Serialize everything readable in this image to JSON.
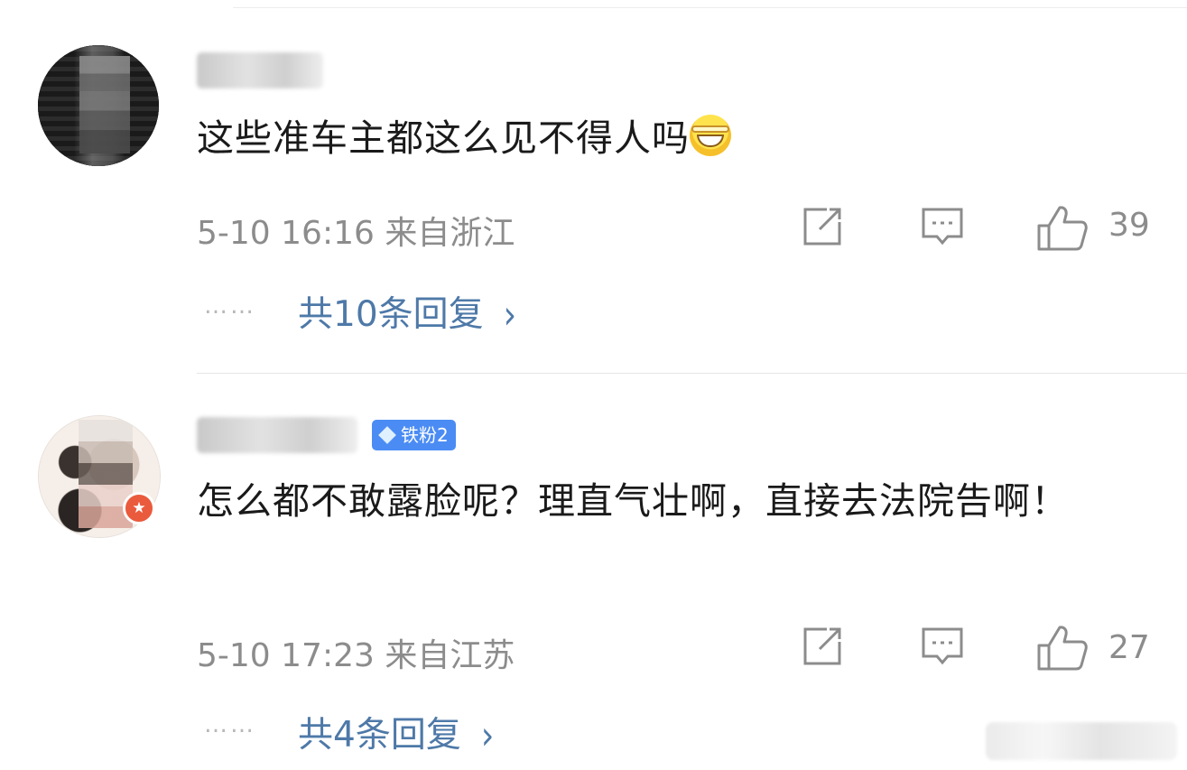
{
  "comments": [
    {
      "text": "这些准车主都这么见不得人吗",
      "emoji": "laughing-crying-emoji",
      "time": "5-10 16:16",
      "location": "来自浙江",
      "likes": "39",
      "replies": "共10条回复",
      "dots": "……"
    },
    {
      "badge": "铁粉2",
      "text": "怎么都不敢露脸呢？理直气壮啊，直接去法院告啊！",
      "time": "5-10 17:23",
      "location": "来自江苏",
      "likes": "27",
      "replies": "共4条回复",
      "dots": "……"
    }
  ],
  "icons": {
    "share": "share-icon",
    "comment": "comment-icon",
    "like": "thumbs-up-icon",
    "chevron": "chevron-right-icon"
  },
  "colors": {
    "reply_link": "#4e79a8",
    "fan_badge": "#4b8cf4",
    "meta_text": "#8c8c8c",
    "verified_badge": "#ea5a3c"
  }
}
